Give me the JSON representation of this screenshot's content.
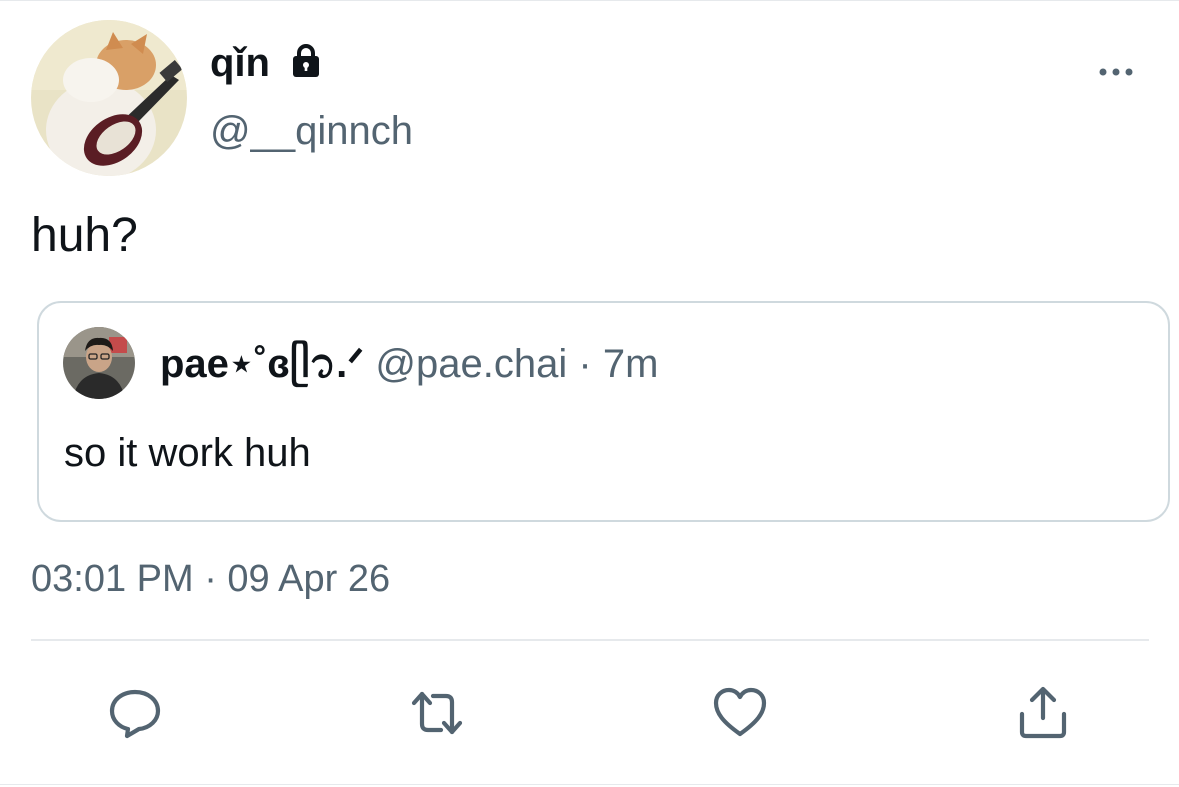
{
  "tweet": {
    "author": {
      "display_name": "qǐn",
      "handle": "@__qinnch",
      "avatar_icon": "cat-with-guitar-avatar",
      "protected_icon": "lock-icon"
    },
    "more_icon": "more-horizontal-icon",
    "text": "huh?",
    "timestamp": "03:01 PM · 09 Apr 26"
  },
  "quote": {
    "author": {
      "display_name": "pae⋆˚ɞᥫ᭡.ᐟ",
      "handle": "@pae.chai",
      "avatar_icon": "person-avatar"
    },
    "separator": "·",
    "time": "7m",
    "text": "so it work huh"
  },
  "actions": [
    {
      "name": "reply",
      "icon": "reply-icon"
    },
    {
      "name": "retweet",
      "icon": "retweet-icon"
    },
    {
      "name": "like",
      "icon": "heart-icon"
    },
    {
      "name": "share",
      "icon": "share-icon"
    }
  ],
  "colors": {
    "text_primary": "#0f1419",
    "text_secondary": "#536471",
    "border": "#cfd9de",
    "divider": "#e6e9ec",
    "background": "#ffffff"
  }
}
